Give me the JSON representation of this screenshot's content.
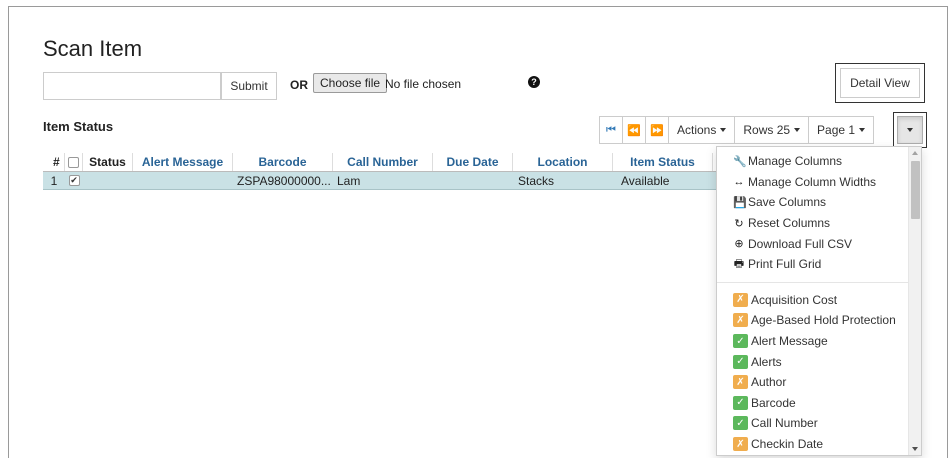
{
  "page": {
    "title": "Scan Item"
  },
  "scan": {
    "input_value": "",
    "input_placeholder": "",
    "submit_label": "Submit",
    "or_label": "OR",
    "choose_file_label": "Choose file",
    "no_file_label": "No file chosen",
    "help_icon": "question-circle-icon",
    "detail_view_label": "Detail View"
  },
  "section": {
    "title": "Item Status"
  },
  "toolbar": {
    "first_icon": "first-page-icon",
    "prev_icon": "previous-page-icon",
    "next_icon": "next-page-icon",
    "actions_label": "Actions",
    "rows_label": "Rows 25",
    "page_label": "Page 1",
    "menu_icon": "caret-down-icon"
  },
  "grid": {
    "columns": [
      "#",
      "",
      "Status",
      "Alert Message",
      "Barcode",
      "Call Number",
      "Due Date",
      "Location",
      "Item Status"
    ],
    "rows": [
      {
        "num": "1",
        "checked": true,
        "status": "",
        "alert": "",
        "barcode": "ZSPA98000000...",
        "call_number": "Lam",
        "due_date": "",
        "location": "Stacks",
        "item_status": "Available"
      }
    ],
    "selected_row_color": "#c9e1e5"
  },
  "menu": {
    "actions": [
      {
        "label": "Manage Columns",
        "icon": "wrench-icon"
      },
      {
        "label": "Manage Column Widths",
        "icon": "resize-horizontal-icon"
      },
      {
        "label": "Save Columns",
        "icon": "floppy-disk-icon"
      },
      {
        "label": "Reset Columns",
        "icon": "refresh-icon"
      },
      {
        "label": "Download Full CSV",
        "icon": "download-icon"
      },
      {
        "label": "Print Full Grid",
        "icon": "print-icon"
      }
    ],
    "columns": [
      {
        "label": "Acquisition Cost",
        "visible": false
      },
      {
        "label": "Age-Based Hold Protection",
        "visible": false
      },
      {
        "label": "Alert Message",
        "visible": true
      },
      {
        "label": "Alerts",
        "visible": true
      },
      {
        "label": "Author",
        "visible": false
      },
      {
        "label": "Barcode",
        "visible": true
      },
      {
        "label": "Call Number",
        "visible": true
      },
      {
        "label": "Checkin Date",
        "visible": false
      }
    ],
    "visible_color": "#5cb85c",
    "hidden_color": "#f0ad4e"
  }
}
